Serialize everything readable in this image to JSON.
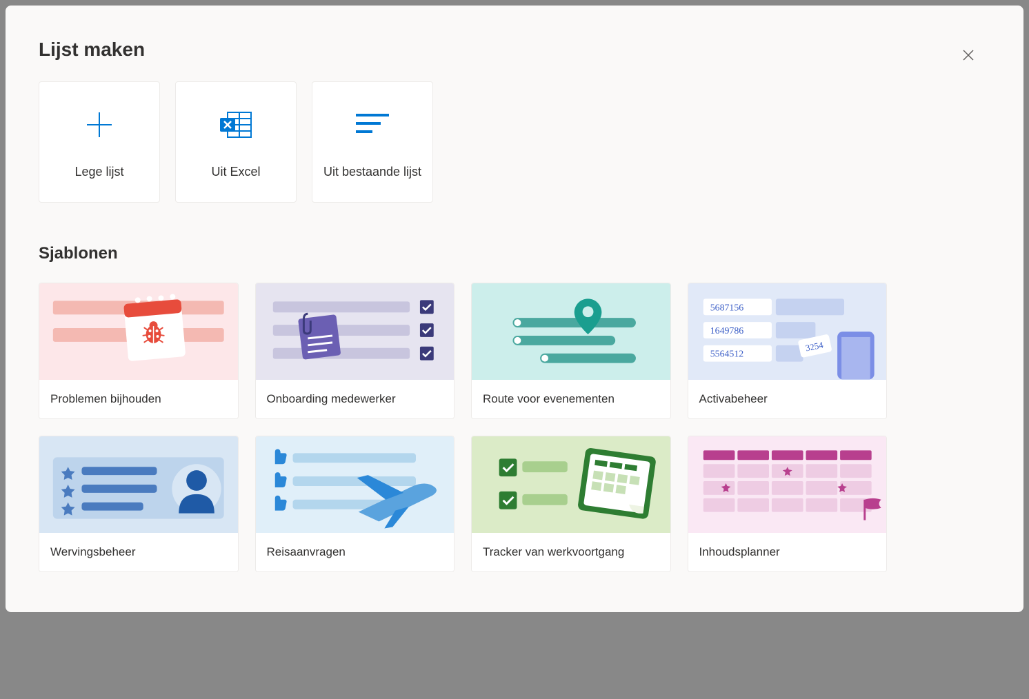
{
  "dialog": {
    "title": "Lijst maken",
    "close_label": "Close"
  },
  "create_options": [
    {
      "id": "blank",
      "label": "Lege lijst"
    },
    {
      "id": "excel",
      "label": "Uit Excel"
    },
    {
      "id": "existing",
      "label": "Uit bestaande lijst"
    }
  ],
  "sections": {
    "templates_heading": "Sjablonen"
  },
  "templates": [
    {
      "id": "issue-tracker",
      "label": "Problemen bijhouden",
      "bg": "bg-red"
    },
    {
      "id": "employee-onboarding",
      "label": "Onboarding medewerker",
      "bg": "bg-purple"
    },
    {
      "id": "event-itinerary",
      "label": "Route voor evenementen",
      "bg": "bg-teal"
    },
    {
      "id": "asset-manager",
      "label": "Activabeheer",
      "bg": "bg-lblue"
    },
    {
      "id": "recruitment-tracker",
      "label": "Wervingsbeheer",
      "bg": "bg-blue"
    },
    {
      "id": "travel-requests",
      "label": "Reisaanvragen",
      "bg": "bg-cyan"
    },
    {
      "id": "work-progress-tracker",
      "label": "Tracker van werkvoortgang",
      "bg": "bg-green"
    },
    {
      "id": "content-scheduler",
      "label": "Inhoudsplanner",
      "bg": "bg-pink"
    }
  ],
  "asset_numbers": [
    "5687156",
    "1649786",
    "5564512",
    "3254"
  ]
}
